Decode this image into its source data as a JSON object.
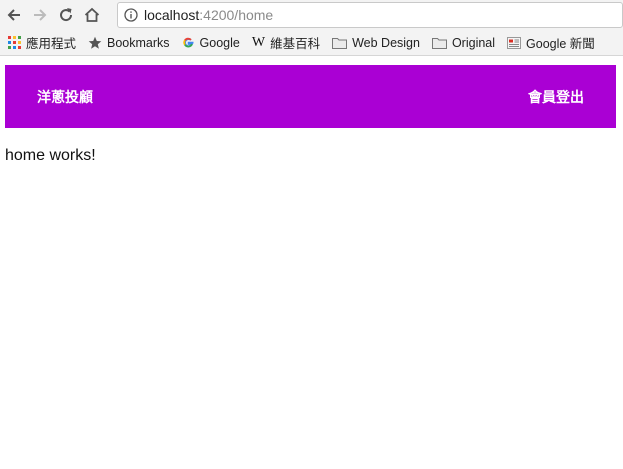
{
  "browser": {
    "url_host": "localhost",
    "url_path": ":4200/home"
  },
  "bookmarks": {
    "items": [
      {
        "label": "應用程式",
        "icon": "apps-grid-icon"
      },
      {
        "label": "Bookmarks",
        "icon": "star-icon"
      },
      {
        "label": "Google",
        "icon": "google-g-icon"
      },
      {
        "label": "維基百科",
        "icon": "wikipedia-w-icon"
      },
      {
        "label": "Web Design",
        "icon": "folder-icon"
      },
      {
        "label": "Original",
        "icon": "folder-icon"
      },
      {
        "label": "Google 新聞",
        "icon": "news-icon"
      }
    ]
  },
  "app": {
    "brand": "洋蔥投顧",
    "logout_label": "會員登出",
    "accent_color": "#aa00d4",
    "content_text": "home works!"
  }
}
